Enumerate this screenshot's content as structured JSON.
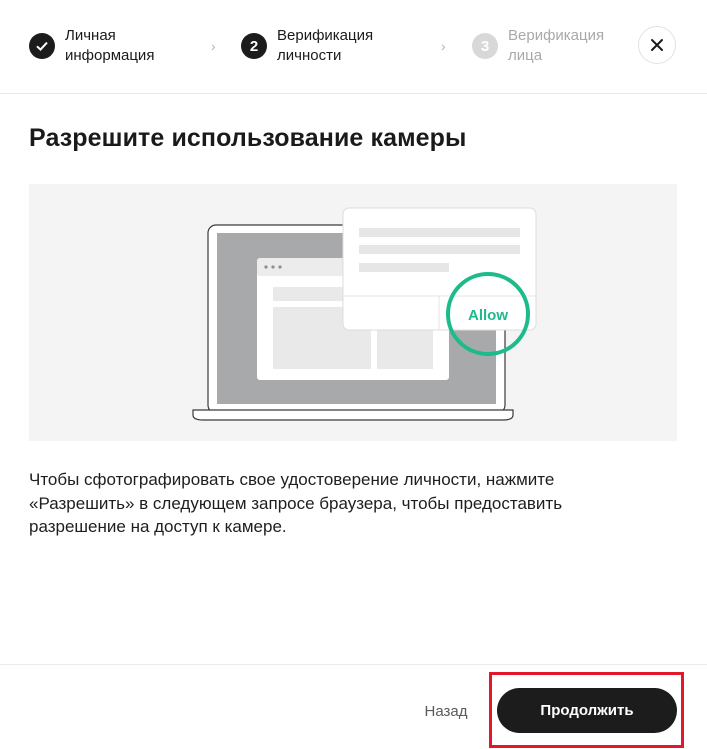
{
  "stepper": {
    "steps": [
      {
        "number": "",
        "label_line1": "Личная",
        "label_line2": "информация",
        "state": "done"
      },
      {
        "number": "2",
        "label_line1": "Верификация",
        "label_line2": "личности",
        "state": "active"
      },
      {
        "number": "3",
        "label_line1": "Верификация",
        "label_line2": "лица",
        "state": "pending"
      }
    ],
    "separator_icon": "chevron-right-icon",
    "close_icon": "close-icon"
  },
  "main": {
    "title": "Разрешите использование камеры",
    "illustration": {
      "allow_label": "Allow",
      "accent_color": "#1dbb8c"
    },
    "description_line1": "Чтобы сфотографировать свое удостоверение личности, нажмите",
    "description_line2": "«Разрешить» в следующем запросе браузера, чтобы предоставить",
    "description_line3": "разрешение на доступ к камере."
  },
  "footer": {
    "back_label": "Назад",
    "continue_label": "Продолжить"
  },
  "colors": {
    "primary_button": "#1c1c1c",
    "highlight_border": "#e0182a",
    "pending_step": "#d8d8d8"
  }
}
